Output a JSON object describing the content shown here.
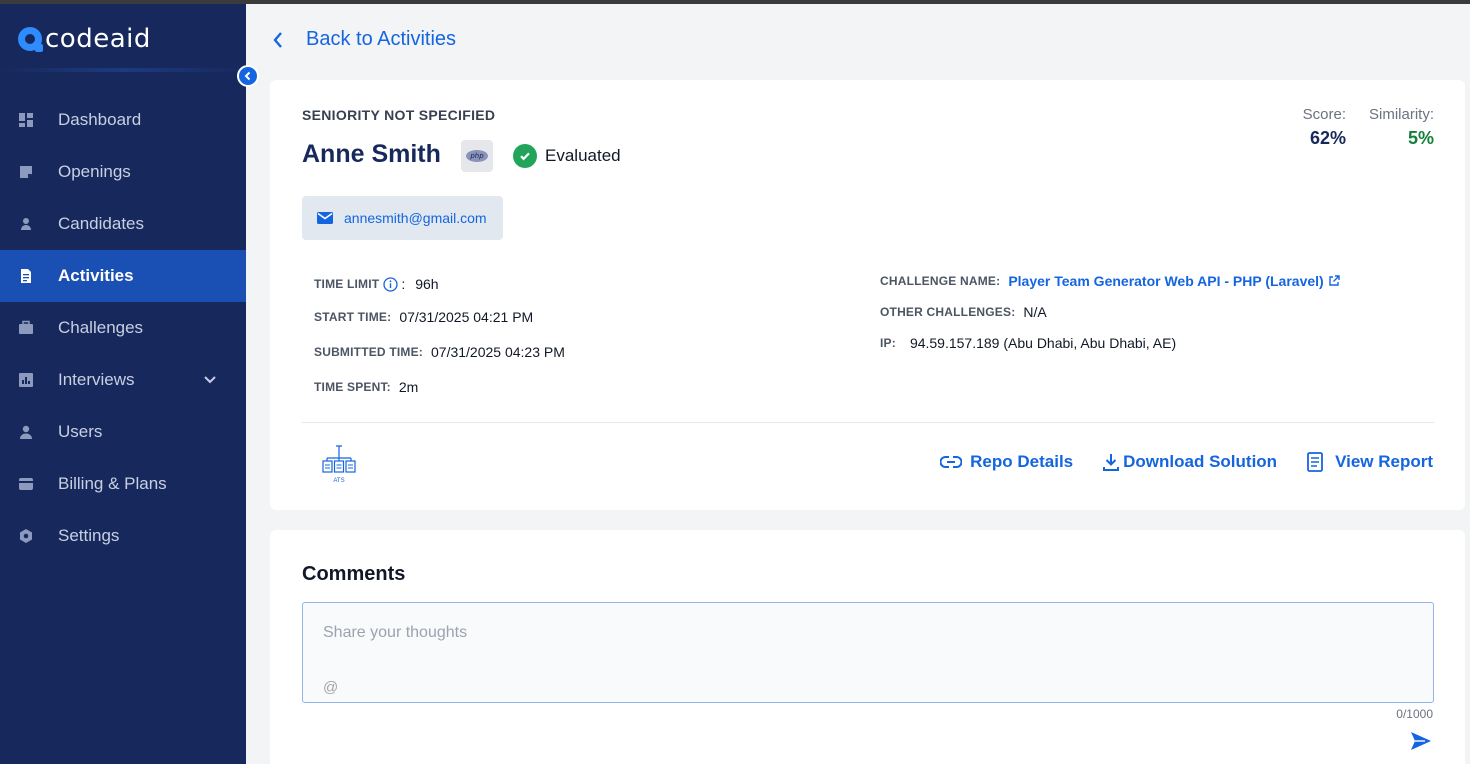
{
  "app": {
    "logo_text": "codeaid"
  },
  "sidebar": {
    "items": [
      {
        "label": "Dashboard",
        "icon": "dashboard-icon"
      },
      {
        "label": "Openings",
        "icon": "openings-icon"
      },
      {
        "label": "Candidates",
        "icon": "person-icon"
      },
      {
        "label": "Activities",
        "icon": "document-icon",
        "active": true
      },
      {
        "label": "Challenges",
        "icon": "briefcase-icon"
      },
      {
        "label": "Interviews",
        "icon": "chart-icon",
        "has_submenu": true
      },
      {
        "label": "Users",
        "icon": "users-icon"
      },
      {
        "label": "Billing & Plans",
        "icon": "card-icon"
      },
      {
        "label": "Settings",
        "icon": "gear-icon"
      }
    ]
  },
  "back_link": "Back to Activities",
  "candidate": {
    "seniority": "SENIORITY NOT SPECIFIED",
    "name": "Anne Smith",
    "language_badge": "php",
    "status": "Evaluated",
    "email": "annesmith@gmail.com",
    "score_label": "Score:",
    "score_value": "62%",
    "similarity_label": "Similarity:",
    "similarity_value": "5%"
  },
  "details": {
    "time_limit_label": "TIME LIMIT",
    "time_limit_value": "96h",
    "start_time_label": "START TIME:",
    "start_time_value": "07/31/2025 04:21 PM",
    "submitted_time_label": "SUBMITTED TIME:",
    "submitted_time_value": "07/31/2025 04:23 PM",
    "time_spent_label": "TIME SPENT:",
    "time_spent_value": "2m",
    "challenge_name_label": "CHALLENGE NAME:",
    "challenge_name_value": "Player Team Generator Web API - PHP (Laravel)",
    "other_challenges_label": "OTHER CHALLENGES:",
    "other_challenges_value": "N/A",
    "ip_label": "IP:",
    "ip_value": "94.59.157.189 (Abu Dhabi, Abu Dhabi, AE)"
  },
  "actions": {
    "ats_label": "ATS",
    "repo_details": "Repo Details",
    "download_solution": "Download Solution",
    "view_report": "View Report"
  },
  "comments": {
    "title": "Comments",
    "placeholder": "Share your thoughts",
    "mention_symbol": "@",
    "counter": "0/1000"
  },
  "colors": {
    "sidebar_bg": "#17295c",
    "sidebar_active": "#1a4fb3",
    "accent": "#1565e0",
    "success": "#22a55b",
    "score": "#17295c",
    "similarity": "#15803d"
  }
}
